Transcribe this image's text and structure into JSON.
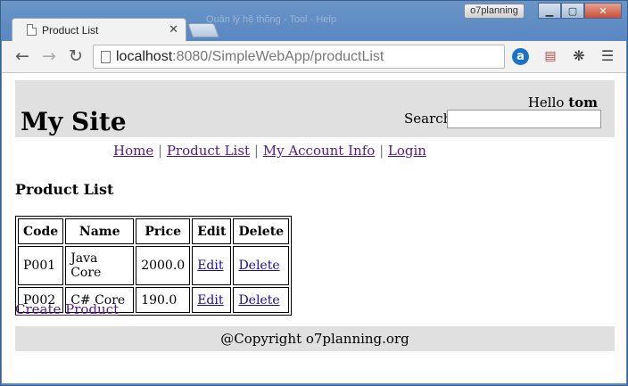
{
  "window": {
    "badge": "o7planning",
    "blurred_title": "Quản lý hệ thống - Tool - Help",
    "controls": {
      "minimize": "▁",
      "maximize": "▢",
      "close": "✕"
    }
  },
  "tab": {
    "title": "Product List",
    "close": "✕"
  },
  "toolbar": {
    "back_icon": "arrow-left",
    "forward_icon": "arrow-right",
    "reload_icon": "reload",
    "url_host": "localhost",
    "url_rest": ":8080/SimpleWebApp/productList",
    "extensions": [
      "a",
      "calendar",
      "fly",
      "menu"
    ]
  },
  "page": {
    "site_title": "My Site",
    "hello_prefix": "Hello ",
    "hello_user": "tom",
    "search_label": "Search",
    "search_value": "",
    "menu": {
      "home": "Home",
      "product_list": "Product List",
      "my_account": "My Account Info",
      "login": "Login",
      "separator": "|"
    },
    "heading": "Product List",
    "table": {
      "headers": [
        "Code",
        "Name",
        "Price",
        "Edit",
        "Delete"
      ],
      "rows": [
        {
          "code": "P001",
          "name": "Java Core",
          "price": "2000.0",
          "edit": "Edit",
          "delete": "Delete"
        },
        {
          "code": "P002",
          "name": "C# Core",
          "price": "190.0",
          "edit": "Edit",
          "delete": "Delete"
        }
      ]
    },
    "create_link": "Create Product",
    "footer": "@Copyright o7planning.org"
  },
  "colors": {
    "header_bg": "#e0e0e0",
    "visited_link": "#551a8b",
    "link": "#1a0dab"
  }
}
